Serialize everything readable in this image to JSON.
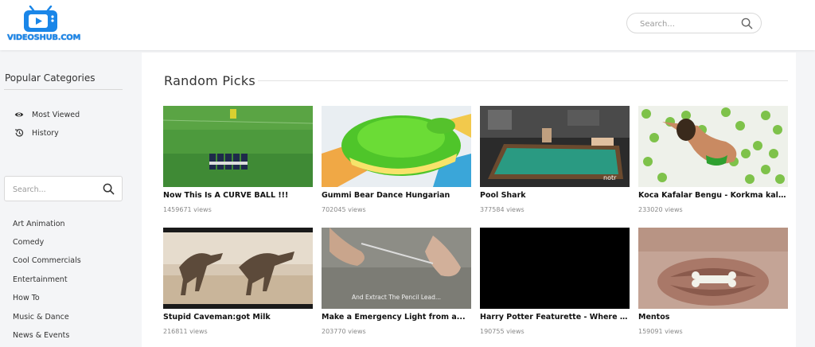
{
  "brand": {
    "logo_text": "VIDEOSHUB.COM"
  },
  "header": {
    "search": {
      "placeholder": "Search..."
    }
  },
  "sidebar": {
    "title": "Popular Categories",
    "nav": [
      {
        "label": "Most Viewed",
        "icon": "eye-icon"
      },
      {
        "label": "History",
        "icon": "history-icon"
      }
    ],
    "search": {
      "placeholder": "Search..."
    },
    "categories": [
      "Art Animation",
      "Comedy",
      "Cool Commercials",
      "Entertainment",
      "How To",
      "Music & Dance",
      "News & Events"
    ]
  },
  "main": {
    "title": "Random Picks",
    "videos": [
      {
        "title": "Now This Is A CURVE BALL !!!",
        "views": "1459671 views"
      },
      {
        "title": "Gummi Bear Dance Hungarian",
        "views": "702045 views"
      },
      {
        "title": "Pool Shark",
        "views": "377584 views"
      },
      {
        "title": "Koca Kafalar Bengu - Korkma kalbim",
        "views": "233020 views"
      },
      {
        "title": "Stupid Caveman:got Milk",
        "views": "216811 views"
      },
      {
        "title": "Make a Emergency Light from a...",
        "views": "203770 views"
      },
      {
        "title": "Harry Potter Featurette - Where We...",
        "views": "190755 views"
      },
      {
        "title": "Mentos",
        "views": "159091 views"
      }
    ],
    "thumbnail_captions": {
      "pool": "notr",
      "pencil": "And Extract The Pencil Lead..."
    }
  },
  "colors": {
    "brand_blue": "#1a86e8",
    "pool_green": "#2a9a82",
    "field_green": "#3f8a35"
  }
}
